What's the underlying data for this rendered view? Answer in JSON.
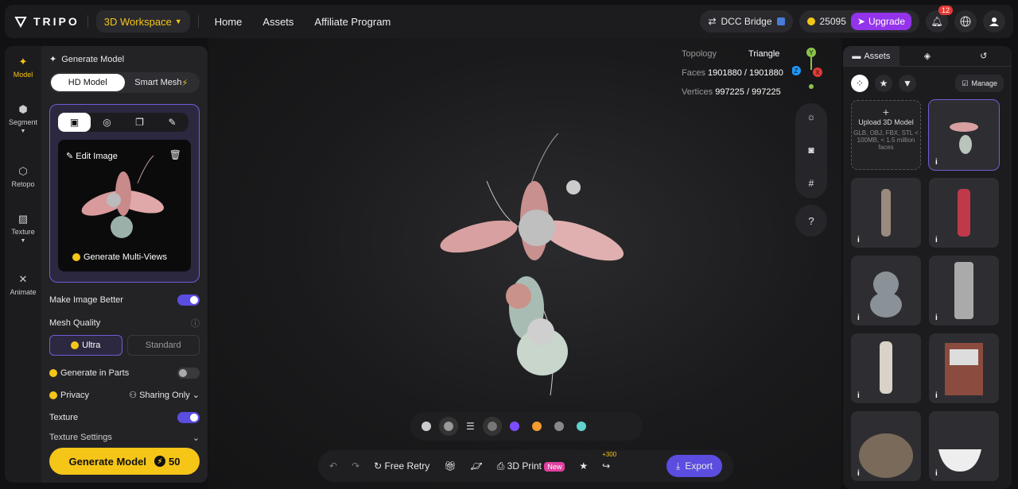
{
  "topbar": {
    "logo": "TRIPO",
    "workspace": "3D Workspace",
    "nav": [
      "Home",
      "Assets",
      "Affiliate Program"
    ],
    "dcc": "DCC Bridge",
    "credits": "25095",
    "upgrade": "Upgrade",
    "notifications": "12"
  },
  "rail": [
    {
      "label": "Model"
    },
    {
      "label": "Segment"
    },
    {
      "label": "Retopo"
    },
    {
      "label": "Texture"
    },
    {
      "label": "Animate"
    }
  ],
  "panel": {
    "title": "Generate Model",
    "mode_hd": "HD Model",
    "mode_smart": "Smart Mesh",
    "edit_image": "Edit Image",
    "multi_views": "Generate Multi-Views",
    "make_better": "Make Image Better",
    "mesh_quality": "Mesh Quality",
    "ultra": "Ultra",
    "standard": "Standard",
    "parts": "Generate in Parts",
    "privacy": "Privacy",
    "sharing": "Sharing Only",
    "texture": "Texture",
    "texture_settings": "Texture Settings",
    "generate": "Generate Model",
    "cost": "50"
  },
  "stats": {
    "topology_label": "Topology",
    "topology": "Triangle",
    "faces_label": "Faces",
    "faces": "1901880 / 1901880",
    "vertices_label": "Vertices",
    "vertices": "997225 / 997225"
  },
  "axes": {
    "y": "Y",
    "z": "Z",
    "x": "X"
  },
  "help": "?",
  "actions": {
    "free_retry": "Free Retry",
    "print": "3D Print",
    "new": "New",
    "plus": "+300",
    "export": "Export"
  },
  "assets": {
    "tab": "Assets",
    "manage": "Manage",
    "upload_title": "Upload 3D Model",
    "upload_hint": "GLB, OBJ, FBX, STL < 100MB, < 1.5 million faces",
    "info": "i"
  }
}
